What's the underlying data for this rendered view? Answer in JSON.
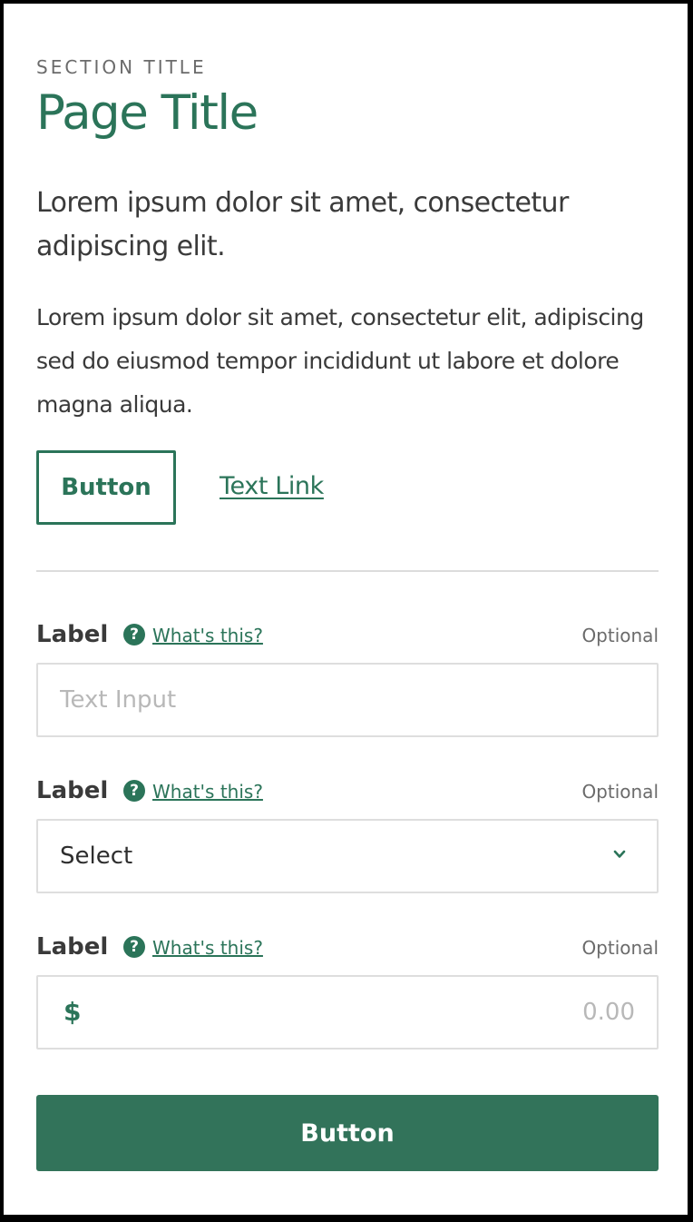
{
  "header": {
    "section_title": "SECTION TITLE",
    "page_title": "Page Title"
  },
  "intro": {
    "lede": "Lorem ipsum dolor sit amet, consectetur adipiscing elit.",
    "body": "Lorem ipsum dolor sit amet, consectetur elit, adipiscing sed do eiusmod tempor incididunt ut labore et dolore magna aliqua."
  },
  "actions": {
    "outline_button_label": "Button",
    "text_link_label": "Text Link"
  },
  "fields": {
    "text": {
      "label": "Label",
      "help_icon": "question-circle-icon",
      "help_icon_glyph": "?",
      "help_link": "What's this?",
      "optional": "Optional",
      "placeholder": "Text Input",
      "value": ""
    },
    "select": {
      "label": "Label",
      "help_icon": "question-circle-icon",
      "help_icon_glyph": "?",
      "help_link": "What's this?",
      "optional": "Optional",
      "selected": "Select",
      "chevron_icon": "chevron-down-icon"
    },
    "currency": {
      "label": "Label",
      "help_icon": "question-circle-icon",
      "help_icon_glyph": "?",
      "help_link": "What's this?",
      "optional": "Optional",
      "currency_symbol": "$",
      "placeholder": "0.00",
      "value": ""
    }
  },
  "primary_button_label": "Button",
  "colors": {
    "accent": "#2b7459",
    "primary_button": "#32735a",
    "border": "#dedede",
    "muted_text": "#6b6b6b"
  }
}
